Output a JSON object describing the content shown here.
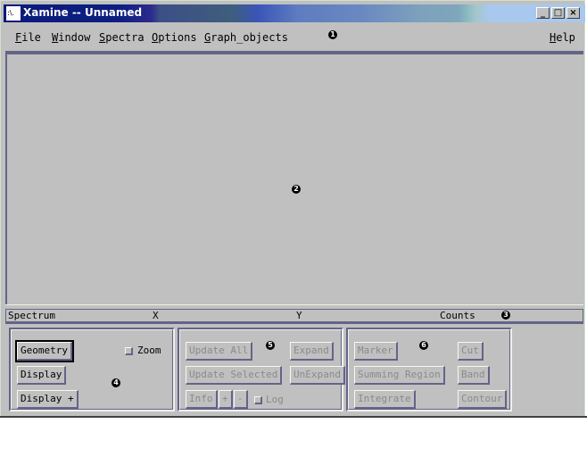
{
  "window": {
    "title": "Xamine -- Unnamed",
    "icon_label": ":\\.",
    "controls": {
      "minimize": "_",
      "maximize": "□",
      "close": "×"
    }
  },
  "menubar": {
    "items": [
      {
        "label": "File",
        "mnemonic": "F",
        "rest": "ile"
      },
      {
        "label": "Window",
        "mnemonic": "W",
        "rest": "indow"
      },
      {
        "label": "Spectra",
        "mnemonic": "S",
        "rest": "pectra"
      },
      {
        "label": "Options",
        "mnemonic": "O",
        "rest": "ptions"
      },
      {
        "label": "Graph_objects",
        "mnemonic": "G",
        "rest": "raph_objects"
      }
    ],
    "help": {
      "label": "Help",
      "mnemonic": "H",
      "rest": "elp"
    }
  },
  "status_bar": {
    "spectrum_label": "Spectrum",
    "x_label": "X",
    "y_label": "Y",
    "counts_label": "Counts"
  },
  "panel_display": {
    "geometry": "Geometry",
    "display": "Display",
    "display_plus": "Display +",
    "zoom_label": "Zoom",
    "zoom_checked": false
  },
  "panel_update": {
    "update_all": "Update All",
    "update_selected": "Update Selected",
    "expand": "Expand",
    "unexpand": "UnExpand",
    "info": "Info",
    "plus": "+",
    "minus": "-",
    "log_label": "Log",
    "log_checked": false
  },
  "panel_graph": {
    "marker": "Marker",
    "summing_region": "Summing Region",
    "integrate": "Integrate",
    "cut": "Cut",
    "band": "Band",
    "contour": "Contour"
  },
  "annotations": [
    "1",
    "2",
    "3",
    "4",
    "5",
    "6"
  ]
}
